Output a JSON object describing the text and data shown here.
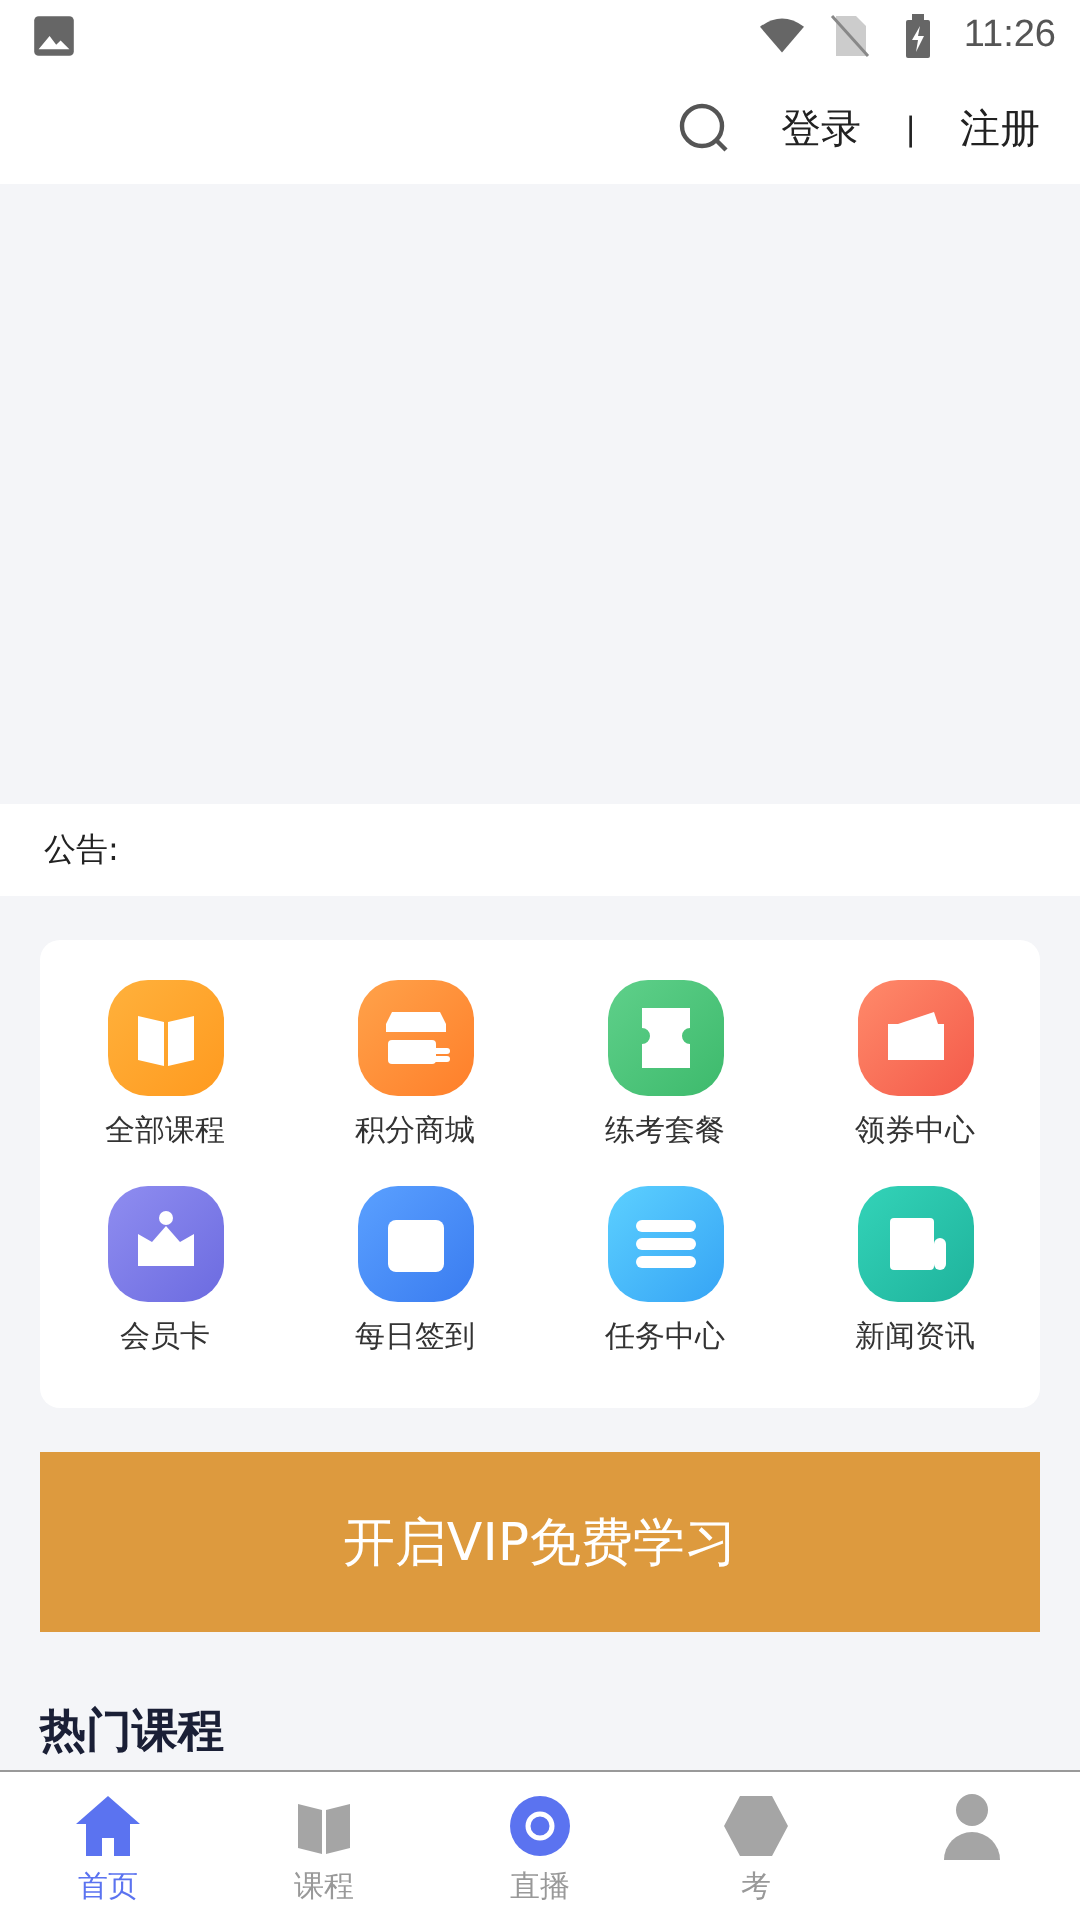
{
  "status_bar": {
    "time": "11:26"
  },
  "header": {
    "login": "登录",
    "separator": "|",
    "register": "注册"
  },
  "notice": {
    "label": "公告:"
  },
  "shortcuts": [
    {
      "label": "全部课程"
    },
    {
      "label": "积分商城"
    },
    {
      "label": "练考套餐"
    },
    {
      "label": "领券中心"
    },
    {
      "label": "会员卡"
    },
    {
      "label": "每日签到"
    },
    {
      "label": "任务中心"
    },
    {
      "label": "新闻资讯"
    }
  ],
  "vip_button": {
    "label": "开启VIP免费学习"
  },
  "section_title": "热门课程",
  "bottom_nav": [
    {
      "label": "首页",
      "selected": true
    },
    {
      "label": "课程",
      "selected": false
    },
    {
      "label": "直播",
      "selected": false
    },
    {
      "label": "考",
      "selected": false
    },
    {
      "selected": false
    }
  ]
}
